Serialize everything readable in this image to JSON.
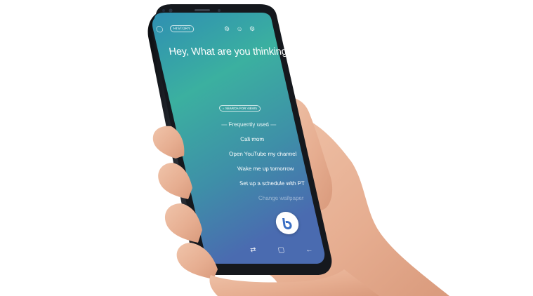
{
  "header": {
    "history_label": "HISTORY",
    "icons": [
      "settings-icon",
      "chat-icon",
      "gear-icon"
    ]
  },
  "greeting": "Hey, What are you thinking?",
  "search_label": "SEARCH FOR VIEWS",
  "frequently_used": {
    "title": "— Frequently used —",
    "items": [
      "Call mom",
      "Open YouTube my channel",
      "Wake me up tomorrow",
      "Set up a schedule with PT",
      "Change wallpaper"
    ]
  },
  "nav_icons": [
    "recents-icon",
    "home-icon",
    "back-icon"
  ],
  "colors": {
    "screen_top": "#2f8fb2",
    "screen_mid": "#3bb0a0",
    "screen_bottom": "#4a6bb0",
    "phone_body": "#15181d",
    "skin": "#e9b59a",
    "bixby_icon": "#3a6fc4"
  }
}
